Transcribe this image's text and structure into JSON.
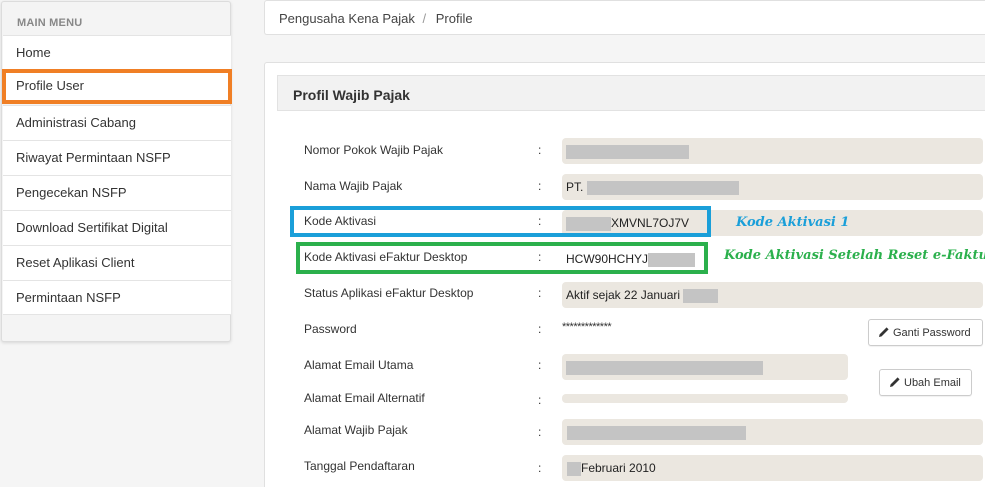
{
  "sidebar": {
    "title": "MAIN MENU",
    "items": [
      {
        "label": "Home"
      },
      {
        "label": "Profile User"
      },
      {
        "label": "Administrasi Cabang"
      },
      {
        "label": "Riwayat Permintaan NSFP"
      },
      {
        "label": "Pengecekan NSFP"
      },
      {
        "label": "Download Sertifikat Digital"
      },
      {
        "label": "Reset Aplikasi Client"
      },
      {
        "label": "Permintaan NSFP"
      }
    ],
    "active_item": "Profile User"
  },
  "breadcrumb": {
    "parent": "Pengusaha Kena Pajak",
    "separator": "/",
    "current": "Profile"
  },
  "panel": {
    "title": "Profil Wajib Pajak",
    "separator": ":",
    "fields": {
      "npwp": {
        "label": "Nomor Pokok Wajib Pajak",
        "value": ""
      },
      "nama": {
        "label": "Nama Wajib Pajak",
        "value": "PT."
      },
      "kode_aktivasi": {
        "label": "Kode Aktivasi",
        "value": "XMVNL7OJ7V"
      },
      "kode_efaktur": {
        "label": "Kode Aktivasi eFaktur Desktop",
        "value": "HCW90HCHYJ"
      },
      "status": {
        "label": "Status Aplikasi eFaktur Desktop",
        "value": "Aktif sejak 22 Januari"
      },
      "password": {
        "label": "Password",
        "value": "*************"
      },
      "email_utama": {
        "label": "Alamat Email Utama",
        "value": ""
      },
      "email_alt": {
        "label": "Alamat Email Alternatif",
        "value": ""
      },
      "alamat": {
        "label": "Alamat Wajib Pajak",
        "value": ""
      },
      "tanggal": {
        "label": "Tanggal Pendaftaran",
        "value": "Februari 2010"
      }
    },
    "buttons": {
      "ganti_password": "Ganti Password",
      "ubah_email": "Ubah Email"
    }
  },
  "annotations": {
    "kode_aktivasi_1": "Kode Aktivasi 1",
    "kode_reset": "Kode Aktivasi Setelah Reset e-Faktur"
  },
  "colors": {
    "active_outline": "#f07f25",
    "blue_highlight": "#1a9fd9",
    "green_highlight": "#2bb04c",
    "annotation_blue": "#1a9fd9",
    "annotation_green": "#2bb04c",
    "field_bg": "#ebe7e0"
  },
  "icons": [
    "pencil-icon"
  ]
}
